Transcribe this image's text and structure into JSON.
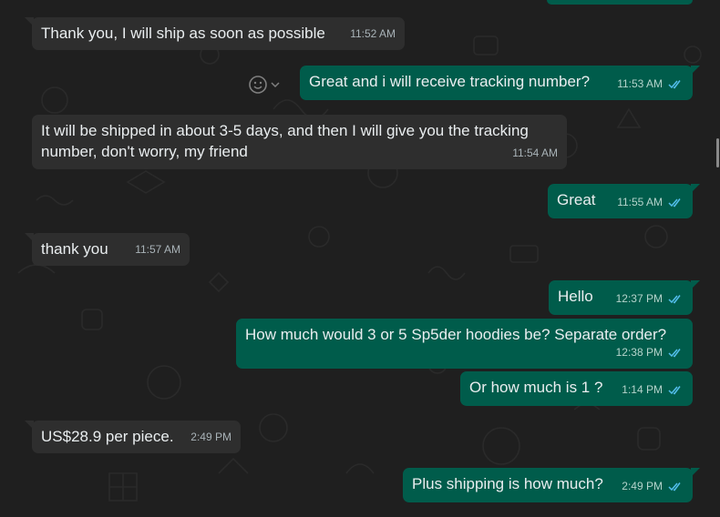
{
  "chat": {
    "messages": [
      {
        "dir": "in",
        "text": "Thank you, I will ship as soon as possible",
        "time": "11:52 AM"
      },
      {
        "dir": "out",
        "text": "Great and i will receive tracking number?",
        "time": "11:53 AM",
        "read": true
      },
      {
        "dir": "in",
        "text": "It will be shipped in about 3-5 days, and then I will give you the tracking number, don't worry, my friend",
        "time": "11:54 AM"
      },
      {
        "dir": "out",
        "text": "Great",
        "time": "11:55 AM",
        "read": true
      },
      {
        "dir": "in",
        "text": "thank you",
        "time": "11:57 AM"
      },
      {
        "dir": "out",
        "text": "Hello",
        "time": "12:37 PM",
        "read": true
      },
      {
        "dir": "out",
        "text": "How much would 3 or 5 Sp5der hoodies be? Separate order?",
        "time": "12:38 PM",
        "read": true
      },
      {
        "dir": "out",
        "text": "Or how much is 1 ?",
        "time": "1:14 PM",
        "read": true
      },
      {
        "dir": "in",
        "text": "US$28.9 per piece.",
        "time": "2:49 PM"
      },
      {
        "dir": "out",
        "text": "Plus shipping is how much?",
        "time": "2:49 PM",
        "read": true
      }
    ]
  },
  "icons": {
    "react": "emoji-reaction-icon",
    "read_receipt": "double-check-icon"
  },
  "colors": {
    "background": "#1f1f1f",
    "incoming_bubble": "#2e2e2e",
    "outgoing_bubble": "#005c4b",
    "read_tick": "#53bdeb",
    "text": "#e9edef"
  }
}
